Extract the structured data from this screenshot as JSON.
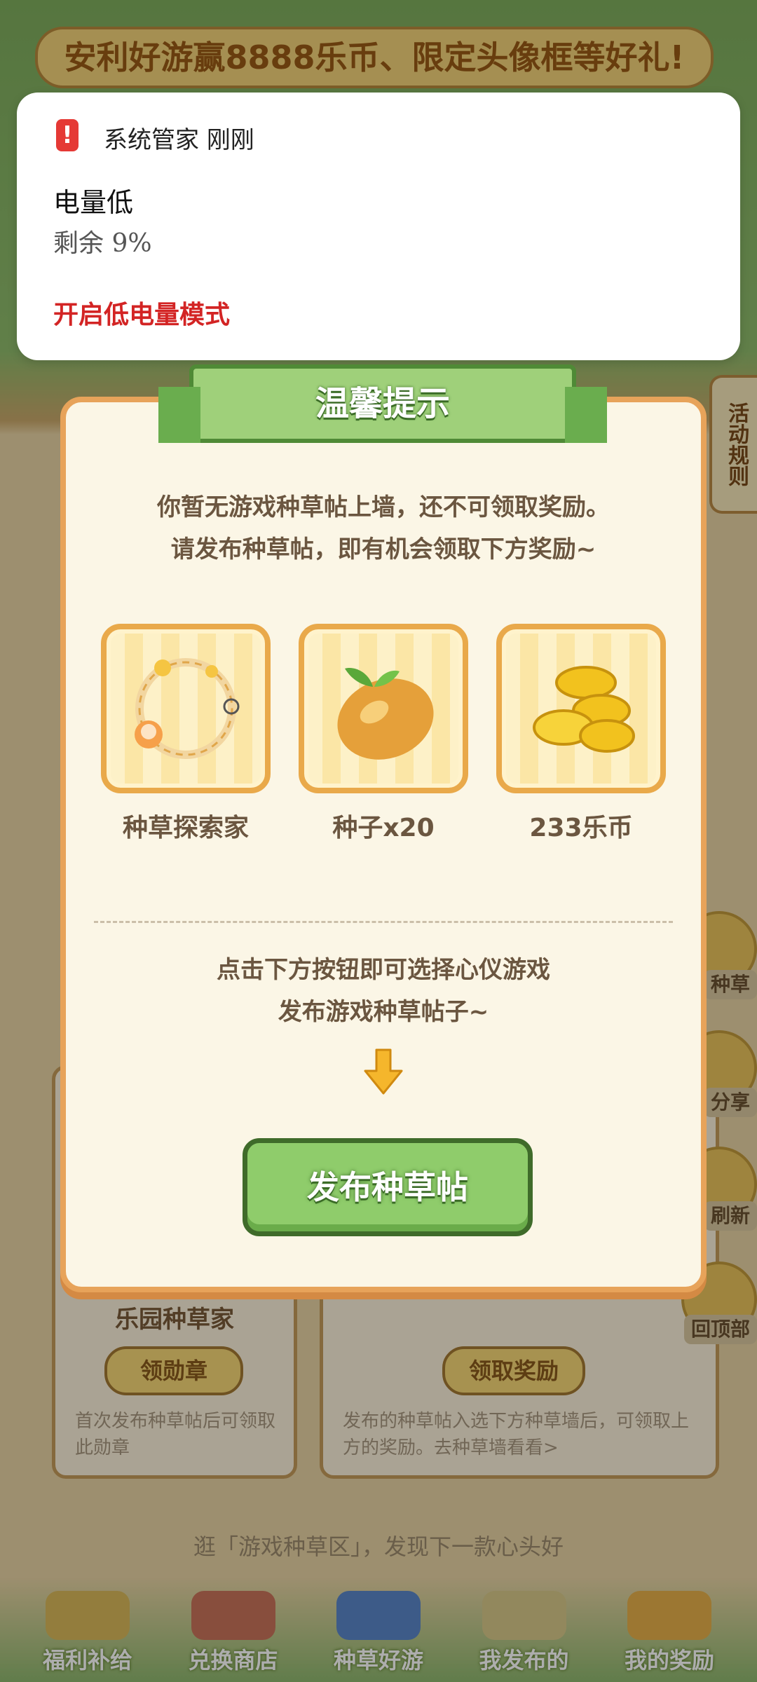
{
  "background": {
    "banner": "安利好游赢8888乐币、限定头像框等好礼!",
    "rules_tab": "活动规则",
    "left_card": {
      "title": "乐园种草家",
      "button": "领勋章",
      "desc": "首次发布种草帖后可领取此勋章"
    },
    "right_card": {
      "button": "领取奖励",
      "desc": "发布的种草帖入选下方种草墙后，可领取上方的奖励。去种草墙看看>"
    },
    "side_buttons": [
      "种草",
      "分享",
      "刷新",
      "回顶部"
    ],
    "tagline": "逛「游戏种草区」，发现下一款心头好",
    "nav": [
      "福利补给",
      "兑换商店",
      "种草好游",
      "我发布的",
      "我的奖励"
    ]
  },
  "notification": {
    "app": "系统管家  刚刚",
    "icon": "battery-alert-icon",
    "title": "电量低",
    "body": "剩余 9%",
    "action": "开启低电量模式"
  },
  "dialog": {
    "title": "温馨提示",
    "message_line1": "你暂无游戏种草帖上墙，还不可领取奖励。",
    "message_line2": "请发布种草帖，即有机会领取下方奖励~",
    "rewards": [
      {
        "label": "种草探索家",
        "icon": "avatar-frame-icon"
      },
      {
        "label": "种子x20",
        "icon": "seed-icon"
      },
      {
        "label": "233乐币",
        "icon": "coins-icon"
      }
    ],
    "hint_line1": "点击下方按钮即可选择心仪游戏",
    "hint_line2": "发布游戏种草帖子~",
    "button": "发布种草帖"
  },
  "colors": {
    "dialog_border": "#e7a35a",
    "header_green": "#9fd07a",
    "button_green": "#8fcc6b",
    "alert_red": "#d32424"
  }
}
